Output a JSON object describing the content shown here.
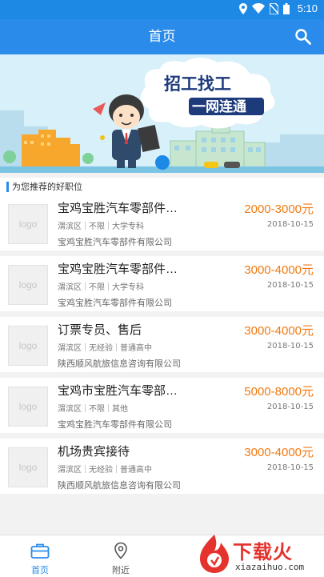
{
  "status_bar": {
    "time": "5:10"
  },
  "app_bar": {
    "title": "首页"
  },
  "banner": {
    "headline_top": "招工找工",
    "headline_bottom": "一网连通"
  },
  "section": {
    "title": "为您推荐的好职位"
  },
  "jobs": [
    {
      "logo": "logo",
      "title": "宝鸡宝胜汽车零部件…",
      "salary": "2000-3000元",
      "tags": [
        "渭滨区",
        "不限",
        "大学专科"
      ],
      "date": "2018-10-15",
      "company": "宝鸡宝胜汽车零部件有限公司"
    },
    {
      "logo": "logo",
      "title": "宝鸡宝胜汽车零部件…",
      "salary": "3000-4000元",
      "tags": [
        "渭滨区",
        "不限",
        "大学专科"
      ],
      "date": "2018-10-15",
      "company": "宝鸡宝胜汽车零部件有限公司"
    },
    {
      "logo": "logo",
      "title": "订票专员、售后",
      "salary": "3000-4000元",
      "tags": [
        "渭滨区",
        "无经验",
        "普通高中"
      ],
      "date": "2018-10-15",
      "company": "陕西顺风航旅信息咨询有限公司"
    },
    {
      "logo": "logo",
      "title": "宝鸡市宝胜汽车零部…",
      "salary": "5000-8000元",
      "tags": [
        "渭滨区",
        "不限",
        "其他"
      ],
      "date": "2018-10-15",
      "company": "宝鸡宝胜汽车零部件有限公司"
    },
    {
      "logo": "logo",
      "title": "机场贵宾接待",
      "salary": "3000-4000元",
      "tags": [
        "渭滨区",
        "无经验",
        "普通高中"
      ],
      "date": "2018-10-15",
      "company": "陕西顺风航旅信息咨询有限公司"
    }
  ],
  "tabs": [
    {
      "label": "首页",
      "icon": "briefcase-icon",
      "active": true
    },
    {
      "label": "附近",
      "icon": "location-pin-icon",
      "active": false
    }
  ],
  "watermark": {
    "text": "下载火",
    "sub": "xiazaihuo.com"
  },
  "colors": {
    "primary": "#2a8bea",
    "salary": "#f07a12",
    "active_tab": "#2a8bea",
    "inactive_tab": "#555555"
  }
}
